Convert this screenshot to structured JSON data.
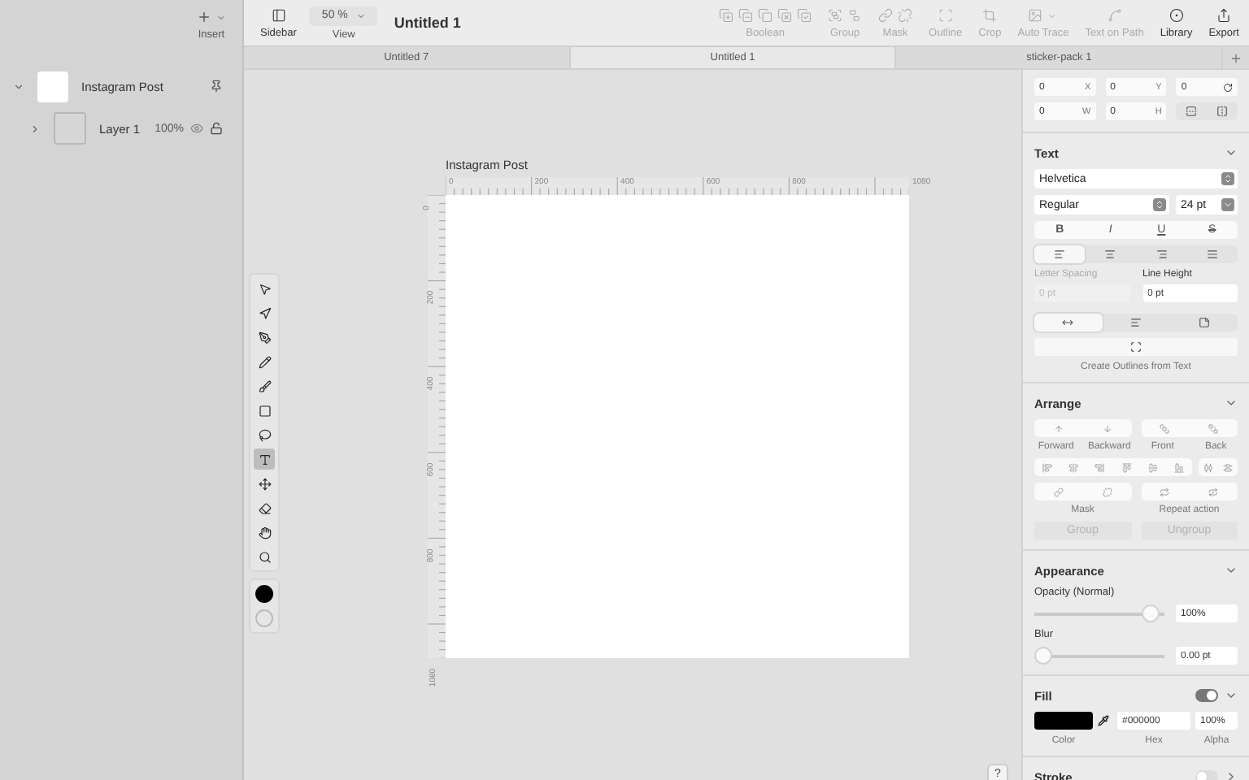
{
  "sidebar": {
    "insert_label": "Insert",
    "artboards": [
      {
        "name": "Instagram Post",
        "expanded": true,
        "children": [
          {
            "name": "Layer 1",
            "expanded": false,
            "opacity": "100%",
            "visible": true,
            "locked": false
          }
        ]
      }
    ]
  },
  "toolbar": {
    "sidebar_label": "Sidebar",
    "zoom": "50 %",
    "view_label": "View",
    "document_title": "Untitled 1",
    "actions": [
      {
        "label": "Boolean",
        "kind": "boolean",
        "disabled": true
      },
      {
        "label": "Group",
        "kind": "group",
        "disabled": true
      },
      {
        "label": "Mask",
        "kind": "mask",
        "disabled": true
      },
      {
        "label": "Outline",
        "kind": "outline",
        "disabled": true
      },
      {
        "label": "Crop",
        "kind": "crop",
        "disabled": true
      },
      {
        "label": "Auto Trace",
        "kind": "trace",
        "disabled": true
      },
      {
        "label": "Text on Path",
        "kind": "textpath",
        "disabled": true
      },
      {
        "label": "Library",
        "kind": "library",
        "disabled": false
      },
      {
        "label": "Export",
        "kind": "export",
        "disabled": false
      }
    ]
  },
  "tabs": [
    {
      "label": "Untitled 7",
      "selected": false
    },
    {
      "label": "Untitled 1",
      "selected": true
    },
    {
      "label": "sticker-pack 1",
      "selected": false
    }
  ],
  "tools": [
    {
      "kind": "select",
      "selected": false
    },
    {
      "kind": "direct",
      "selected": false
    },
    {
      "kind": "pen",
      "selected": false
    },
    {
      "kind": "pencil",
      "selected": false
    },
    {
      "kind": "brush",
      "selected": false
    },
    {
      "kind": "rectangle",
      "selected": false
    },
    {
      "kind": "lasso",
      "selected": false
    },
    {
      "kind": "text",
      "selected": true
    },
    {
      "kind": "transform",
      "selected": false
    },
    {
      "kind": "eraser",
      "selected": false
    },
    {
      "kind": "hand",
      "selected": false
    },
    {
      "kind": "zoom",
      "selected": false
    }
  ],
  "canvas": {
    "artboard_title": "Instagram Post",
    "x_ticks": [
      "0",
      "200",
      "400",
      "600",
      "800",
      "1080"
    ],
    "y_ticks": [
      "0",
      "200",
      "400",
      "600",
      "800",
      "1080"
    ]
  },
  "inspector": {
    "position": {
      "x": {
        "value": "0",
        "label": "X"
      },
      "y": {
        "value": "0",
        "label": "Y"
      },
      "rotation": {
        "value": "0"
      },
      "w": {
        "value": "0",
        "label": "W"
      },
      "h": {
        "value": "0",
        "label": "H"
      }
    },
    "text": {
      "title": "Text",
      "expanded": true,
      "font": "Helvetica",
      "weight": "Regular",
      "size": "24 pt",
      "styles": [
        {
          "label": "B",
          "kind": "bold",
          "selected": false
        },
        {
          "label": "I",
          "kind": "italic",
          "selected": false
        },
        {
          "label": "U",
          "kind": "underline",
          "selected": false
        },
        {
          "label": "S",
          "kind": "strike",
          "selected": false
        }
      ],
      "align": [
        {
          "selected": true
        },
        {
          "selected": false
        },
        {
          "selected": false
        },
        {
          "selected": false
        }
      ],
      "letter_spacing": {
        "label": "Letter Spacing",
        "placeholder": "0 pt",
        "disabled": true
      },
      "line_height": {
        "label": "Line Height",
        "value": "0 pt",
        "disabled": false
      },
      "modes": [
        {
          "selected": true
        },
        {
          "selected": false
        },
        {
          "selected": false
        }
      ],
      "outline_caption": "Create Outlines from Text"
    },
    "arrange": {
      "title": "Arrange",
      "expanded": true,
      "order": [
        "Forward",
        "Backward",
        "Front",
        "Back"
      ],
      "extra": [
        "Mask",
        "Repeat action"
      ],
      "buttons": [
        {
          "label": "Group",
          "disabled": true
        },
        {
          "label": "Ungroup",
          "disabled": true
        }
      ]
    },
    "appearance": {
      "title": "Appearance",
      "expanded": true,
      "opacity_label": "Opacity (Normal)",
      "opacity": {
        "level": 0.95,
        "value": "100%"
      },
      "blur_label": "Blur",
      "blur": {
        "level": 0,
        "value": "0.00 pt"
      }
    },
    "fill": {
      "title": "Fill",
      "expanded": true,
      "on": true,
      "hex": "#000000",
      "alpha": "100%",
      "labels": [
        "Color",
        "Hex",
        "Alpha"
      ]
    },
    "stroke": {
      "title": "Stroke",
      "expanded": false,
      "on": false
    }
  },
  "help": "?"
}
